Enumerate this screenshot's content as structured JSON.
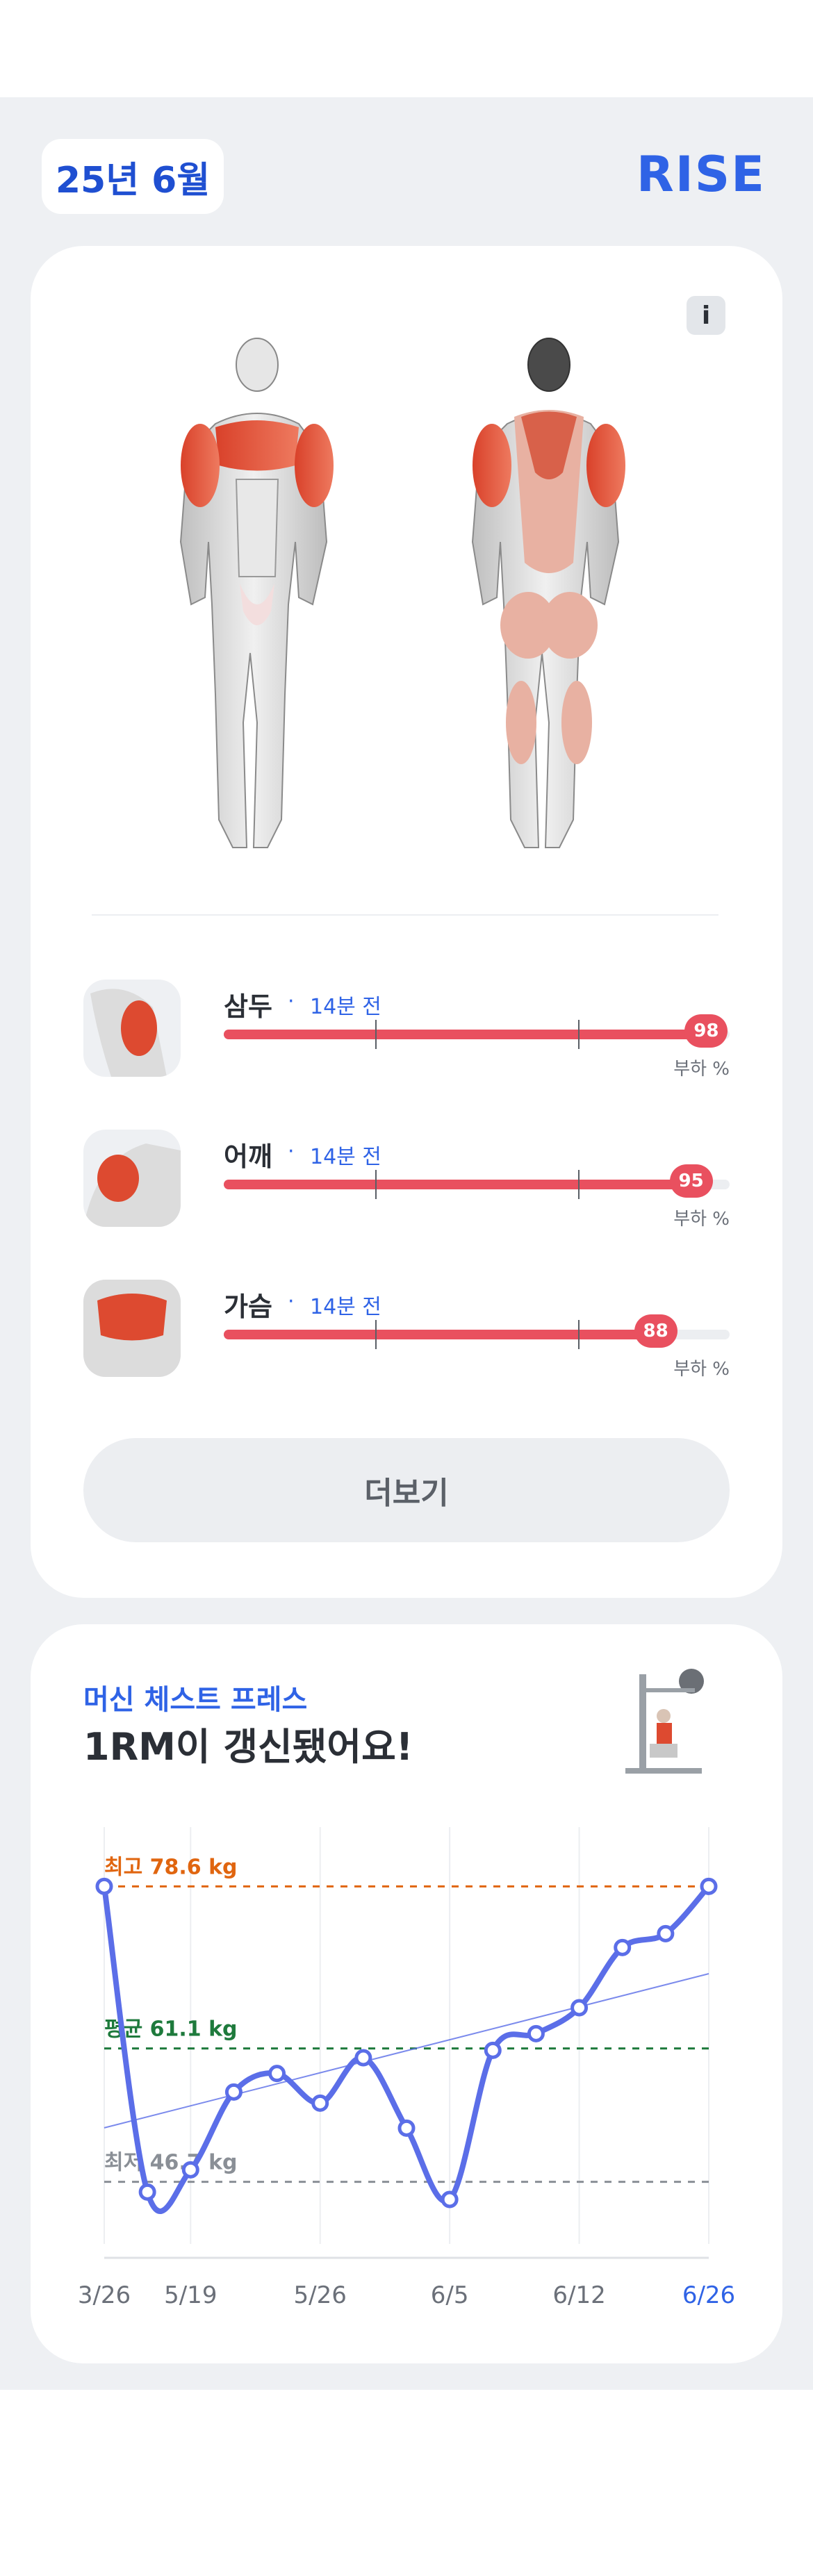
{
  "header": {
    "month": "25년 6월",
    "brand": "RISE"
  },
  "info_button": {
    "label": "i"
  },
  "muscles": [
    {
      "name": "삼두",
      "dot": "·",
      "time": "14분 전",
      "load": 98,
      "load_text": "98",
      "unit_label": "부하 %"
    },
    {
      "name": "어깨",
      "dot": "·",
      "time": "14분 전",
      "load": 95,
      "load_text": "95",
      "unit_label": "부하 %"
    },
    {
      "name": "가슴",
      "dot": "·",
      "time": "14분 전",
      "load": 88,
      "load_text": "88",
      "unit_label": "부하 %"
    }
  ],
  "more_button": {
    "label": "더보기"
  },
  "chart_card": {
    "subtitle": "머신 체스트 프레스",
    "title": "1RM이 갱신됐어요!"
  },
  "colors": {
    "accent": "#2f63e6",
    "bar": "#e9505f",
    "line": "#5b6ee8",
    "max": "#e0650f",
    "avg": "#1e7a3c",
    "min": "#8a8f96"
  },
  "chart_data": {
    "type": "line",
    "x": [
      "3/26",
      "",
      "5/19",
      "",
      "",
      "5/26",
      "",
      "",
      "6/5",
      "",
      "",
      "6/12",
      "",
      "",
      "6/26"
    ],
    "series": [
      {
        "values": [
          78.6,
          45.6,
          48.0,
          56.4,
          58.4,
          55.2,
          60.1,
          52.5,
          44.8,
          60.9,
          62.7,
          65.5,
          72.0,
          73.5,
          78.6
        ]
      }
    ],
    "visible_x_labels": [
      "3/26",
      "5/19",
      "5/26",
      "6/5",
      "6/12",
      "6/26"
    ],
    "reference_lines": [
      {
        "label": "최고 78.6 kg",
        "value": 78.6
      },
      {
        "label": "평균 61.1 kg",
        "value": 61.1
      },
      {
        "label": "최저 46.7 kg",
        "value": 46.7
      }
    ],
    "ylim": [
      40,
      85
    ],
    "grid": true
  }
}
